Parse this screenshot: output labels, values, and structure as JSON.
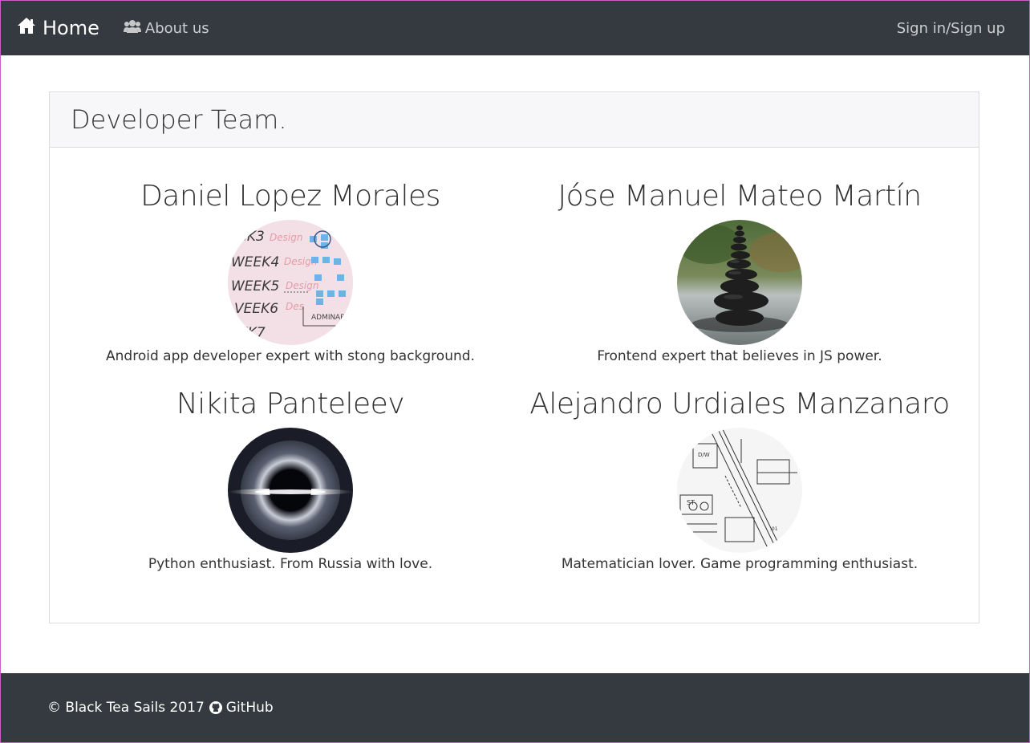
{
  "nav": {
    "home_label": "Home",
    "about_label": "About us",
    "signin_label": "Sign in/Sign up"
  },
  "team": {
    "title": "Developer Team.",
    "members": [
      {
        "name": "Daniel Lopez Morales",
        "description": "Android app developer expert with stong background.",
        "avatar": "whiteboard-photo"
      },
      {
        "name": "Jóse Manuel Mateo Martín",
        "description": "Frontend expert that believes in JS power.",
        "avatar": "stacked-stones-photo"
      },
      {
        "name": "Nikita Panteleev",
        "description": "Python enthusiast. From Russia with love.",
        "avatar": "black-hole-photo"
      },
      {
        "name": "Alejandro Urdiales Manzanaro",
        "description": "Matematician lover. Game programming enthusiast.",
        "avatar": "blueprint-photo"
      }
    ]
  },
  "footer": {
    "copyright": "© Black Tea Sails 2017",
    "github_label": "GitHub"
  },
  "colors": {
    "navbar_bg": "#343a40",
    "footer_bg": "#343a40",
    "card_header_bg": "#f7f7f9"
  }
}
